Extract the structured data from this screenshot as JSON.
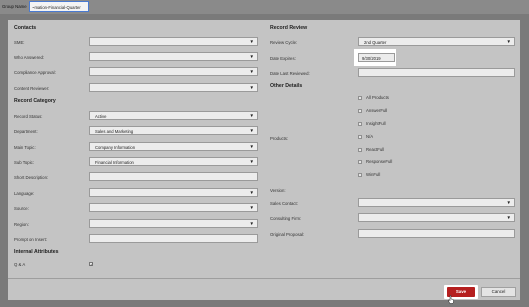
{
  "group_name": {
    "label": "Group Name",
    "value": "~mation-Financial-Quarter"
  },
  "contacts": {
    "title": "Contacts",
    "sme": "SME:",
    "who_answered": "Who Answered:",
    "compliance_approval": "Compliance Approval:",
    "content_reviewer": "Content Reviewer:"
  },
  "record_category": {
    "title": "Record Category",
    "record_status": {
      "label": "Record Status:",
      "value": "Active"
    },
    "department": {
      "label": "Department:",
      "value": "Sales and Marketing"
    },
    "main_topic": {
      "label": "Main Topic:",
      "value": "Company Information"
    },
    "sub_topic": {
      "label": "Sub Topic:",
      "value": "Financial Information"
    },
    "short_description": "Short Description:",
    "language": "Language:",
    "source": "Source:",
    "region": "Region:",
    "prompt_on_insert": "Prompt on Insert:"
  },
  "internal_attributes": {
    "title": "Internal Attributes",
    "qa": "Q & A"
  },
  "record_review": {
    "title": "Record Review",
    "review_cycle": {
      "label": "Review Cycle:",
      "value": "2nd Quarter"
    },
    "date_expires": {
      "label": "Date Expires:",
      "value": "9/30/2019"
    },
    "date_last_reviewed": "Date Last Reviewed:"
  },
  "other_details": {
    "title": "Other Details",
    "products_label": "Products:",
    "products": [
      "All Products",
      "AnswerFull",
      "InsightFull",
      "N/A",
      "ReactFull",
      "ResponseFull",
      "WinFull"
    ],
    "version": "Version:",
    "sales_contact": "Sales Contact:",
    "consulting_firm": "Consulting Firm:",
    "original_proposal": "Original Proposal:"
  },
  "footer": {
    "save": "Save",
    "cancel": "Cancel"
  },
  "colors": {
    "save_button": "#b51f1f",
    "panel": "#c4c4c4",
    "background": "#7a7a7a",
    "focus_border": "#4a7ad0"
  }
}
